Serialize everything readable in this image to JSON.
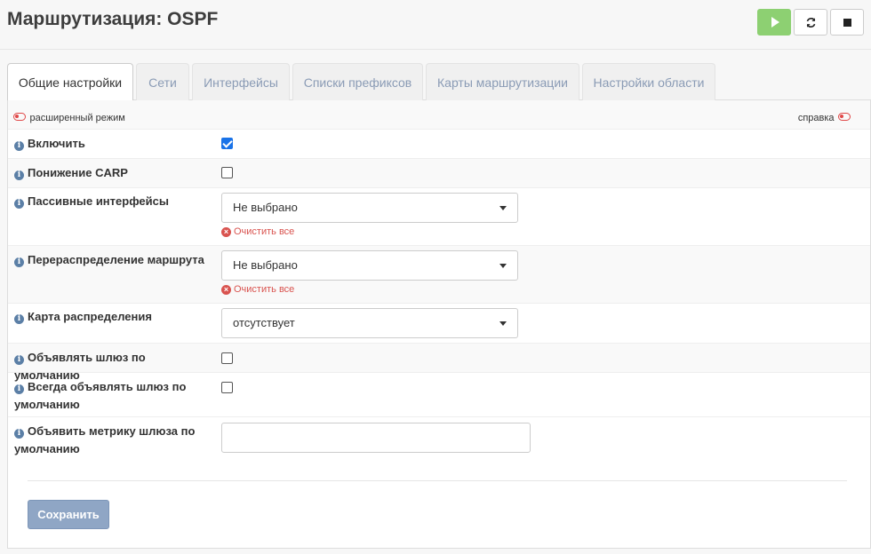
{
  "header": {
    "title": "Маршрутизация: OSPF"
  },
  "tabs": [
    {
      "label": "Общие настройки",
      "active": true
    },
    {
      "label": "Сети"
    },
    {
      "label": "Интерфейсы"
    },
    {
      "label": "Списки префиксов"
    },
    {
      "label": "Карты маршрутизации"
    },
    {
      "label": "Настройки области"
    }
  ],
  "form": {
    "advanced_mode": "расширенный режим",
    "help": "справка",
    "fields": {
      "enable": {
        "label": "Включить",
        "checked": true
      },
      "carp_demote": {
        "label": "Понижение CARP",
        "checked": false
      },
      "passive_interfaces": {
        "label": "Пассивные интерфейсы",
        "value": "Не выбрано",
        "clear": "Очистить все"
      },
      "redistribute": {
        "label": "Перераспределение маршрута",
        "value": "Не выбрано",
        "clear": "Очистить все"
      },
      "distribution_map": {
        "label": "Карта распределения",
        "value": "отсутствует"
      },
      "originate": {
        "label": "Объявлять шлюз по умолчанию",
        "checked": false
      },
      "originate_always": {
        "label": "Всегда объявлять шлюз по умолчанию",
        "checked": false
      },
      "originate_metric": {
        "label": "Объявить метрику шлюза по умолчанию",
        "value": ""
      }
    },
    "save_label": "Сохранить"
  },
  "colors": {
    "start_button": "#8dd072",
    "accent": "#1a73e8",
    "danger": "#d9534f",
    "save_button": "#8fa6c5"
  }
}
